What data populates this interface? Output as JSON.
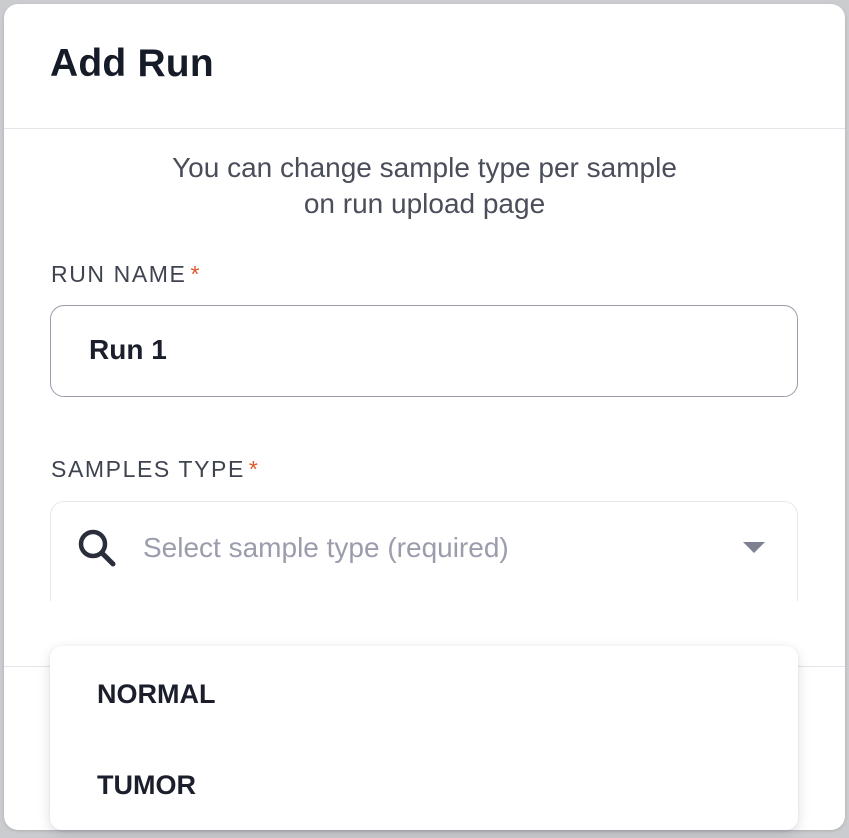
{
  "modal": {
    "title": "Add Run",
    "hint_line1": "You can change sample type per sample",
    "hint_line2": "on run upload page"
  },
  "run_name": {
    "label": "RUN NAME",
    "required_mark": "*",
    "value": "Run 1"
  },
  "samples_type": {
    "label": "SAMPLES TYPE",
    "required_mark": "*",
    "placeholder": "Select sample type (required)",
    "icon": "search-icon",
    "options": [
      "NORMAL",
      "TUMOR"
    ]
  },
  "colors": {
    "required": "#e0572b",
    "text_primary": "#161b28",
    "placeholder": "#9b9dac"
  }
}
